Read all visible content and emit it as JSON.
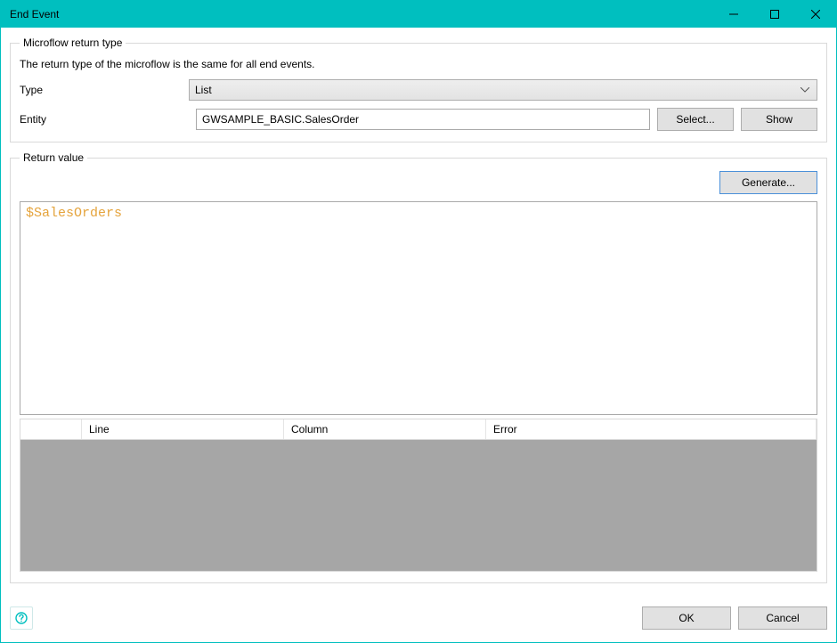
{
  "window": {
    "title": "End Event"
  },
  "returnTypeGroup": {
    "legend": "Microflow return type",
    "description": "The return type of the microflow is the same for all end events.",
    "typeLabel": "Type",
    "typeValue": "List",
    "entityLabel": "Entity",
    "entityValue": "GWSAMPLE_BASIC.SalesOrder",
    "selectButton": "Select...",
    "showButton": "Show"
  },
  "returnValueGroup": {
    "legend": "Return value",
    "generateButton": "Generate...",
    "expression": "$SalesOrders",
    "errorColumns": {
      "line": "Line",
      "column": "Column",
      "error": "Error"
    }
  },
  "footer": {
    "ok": "OK",
    "cancel": "Cancel"
  }
}
